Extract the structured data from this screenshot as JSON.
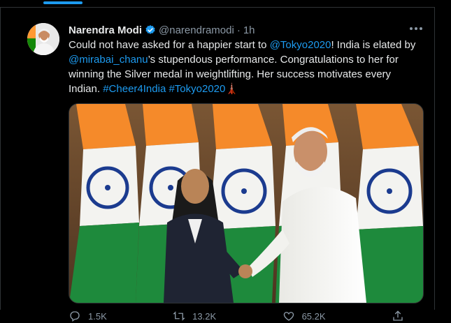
{
  "tweet": {
    "author": {
      "name": "Narendra Modi",
      "handle": "@narendramodi",
      "separator": "·",
      "time": "1h"
    },
    "text": {
      "t1": "Could not have asked for a happier start to ",
      "m1": "@Tokyo2020",
      "t2": "! India is elated by ",
      "m2": "@mirabai_chanu",
      "t3": "’s stupendous performance. Congratulations to her for winning the Silver medal in weightlifting. Her success motivates every Indian. ",
      "h1": "#Cheer4India",
      "space": " ",
      "h2": "#Tokyo2020",
      "emoji": "🗼"
    },
    "actions": {
      "reply_count": "1.5K",
      "retweet_count": "13.2K",
      "like_count": "65.2K"
    }
  },
  "colors": {
    "background": "#000000",
    "accent": "#1d9bf0",
    "muted": "#8b98a5",
    "text": "#e7e9ea",
    "verified": "#1d9bf0"
  },
  "icons": {
    "verified": "verified-badge-icon",
    "more": "more-icon",
    "reply": "reply-icon",
    "retweet": "retweet-icon",
    "like": "like-icon",
    "share": "share-icon"
  }
}
